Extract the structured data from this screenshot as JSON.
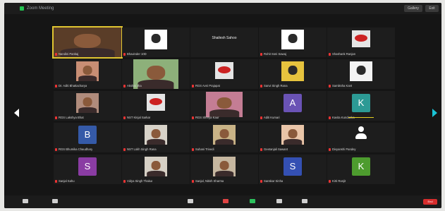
{
  "window": {
    "title": "Zoom Meeting",
    "view_buttons": [
      "Gallery",
      "Exit"
    ]
  },
  "participants": [
    {
      "name": "Nandini Pankaj",
      "kind": "video",
      "tone": "#5a3d28",
      "active": true
    },
    {
      "name": "Bhavinder 10D",
      "kind": "image",
      "tone": "#ffffff"
    },
    {
      "name": "Shailesh Sahoo",
      "kind": "dark"
    },
    {
      "name": "Rohit Soni Sawaj",
      "kind": "image",
      "tone": "#ffffff"
    },
    {
      "name": "Shashank Ranjan",
      "kind": "logo"
    },
    {
      "name": "Dr. Aditi Bhattacharya",
      "kind": "video",
      "tone": "#c88e74"
    },
    {
      "name": "Akshat Jha",
      "kind": "video",
      "tone": "#8db07a"
    },
    {
      "name": "RGS Avni Prajapat",
      "kind": "logo"
    },
    {
      "name": "Sanvi Singh Rana",
      "kind": "image",
      "tone": "#e6c33e"
    },
    {
      "name": "Samiksha Kant",
      "kind": "image",
      "tone": "#f3f3f3"
    },
    {
      "name": "RGS Lakshya Bhat",
      "kind": "video",
      "tone": "#b08c7c"
    },
    {
      "name": "NST Kinjal Sarkar",
      "kind": "logo"
    },
    {
      "name": "RGS Shreya Kaur",
      "kind": "video",
      "tone": "#c47d94"
    },
    {
      "name": "Aditi Kumari",
      "kind": "avatar",
      "letter": "A",
      "tone": "#6a53b5"
    },
    {
      "name": "Kavita Kundanka",
      "kind": "avatar",
      "letter": "K",
      "tone": "#2c9a95",
      "speaker": true
    },
    {
      "name": "RGS Bhumika Chaudhary",
      "kind": "avatar",
      "letter": "B",
      "tone": "#355aa8"
    },
    {
      "name": "NST Lokh Singh Rana",
      "kind": "video",
      "tone": "#d7d2c8"
    },
    {
      "name": "Suhani Trivedi",
      "kind": "video",
      "tone": "#c9b386"
    },
    {
      "name": "Geetanjali Sawant",
      "kind": "video",
      "tone": "#e9c5a8"
    },
    {
      "name": "Divyanshi Pandey",
      "kind": "person"
    },
    {
      "name": "Sanjal Sahu",
      "kind": "avatar",
      "letter": "S",
      "tone": "#8a3ca3"
    },
    {
      "name": "Vidya Singh Thakur",
      "kind": "video",
      "tone": "#d6d0c5"
    },
    {
      "name": "Sanjal, Nitish Sharma",
      "kind": "video",
      "tone": "#c6b7a0"
    },
    {
      "name": "Sanskar Sinha",
      "kind": "avatar",
      "letter": "S",
      "tone": "#3450b3"
    },
    {
      "name": "Kirti Ranjit",
      "kind": "avatar",
      "letter": "K",
      "tone": "#4d9c2e"
    }
  ],
  "toolbar": {
    "items": [
      {
        "label": "Mute"
      },
      {
        "label": "Stop Video"
      },
      {
        "label": "Participants"
      },
      {
        "label": "Chat"
      },
      {
        "label": "Share Screen"
      },
      {
        "label": "Record"
      },
      {
        "label": "Reactions"
      }
    ],
    "end_label": "End"
  }
}
